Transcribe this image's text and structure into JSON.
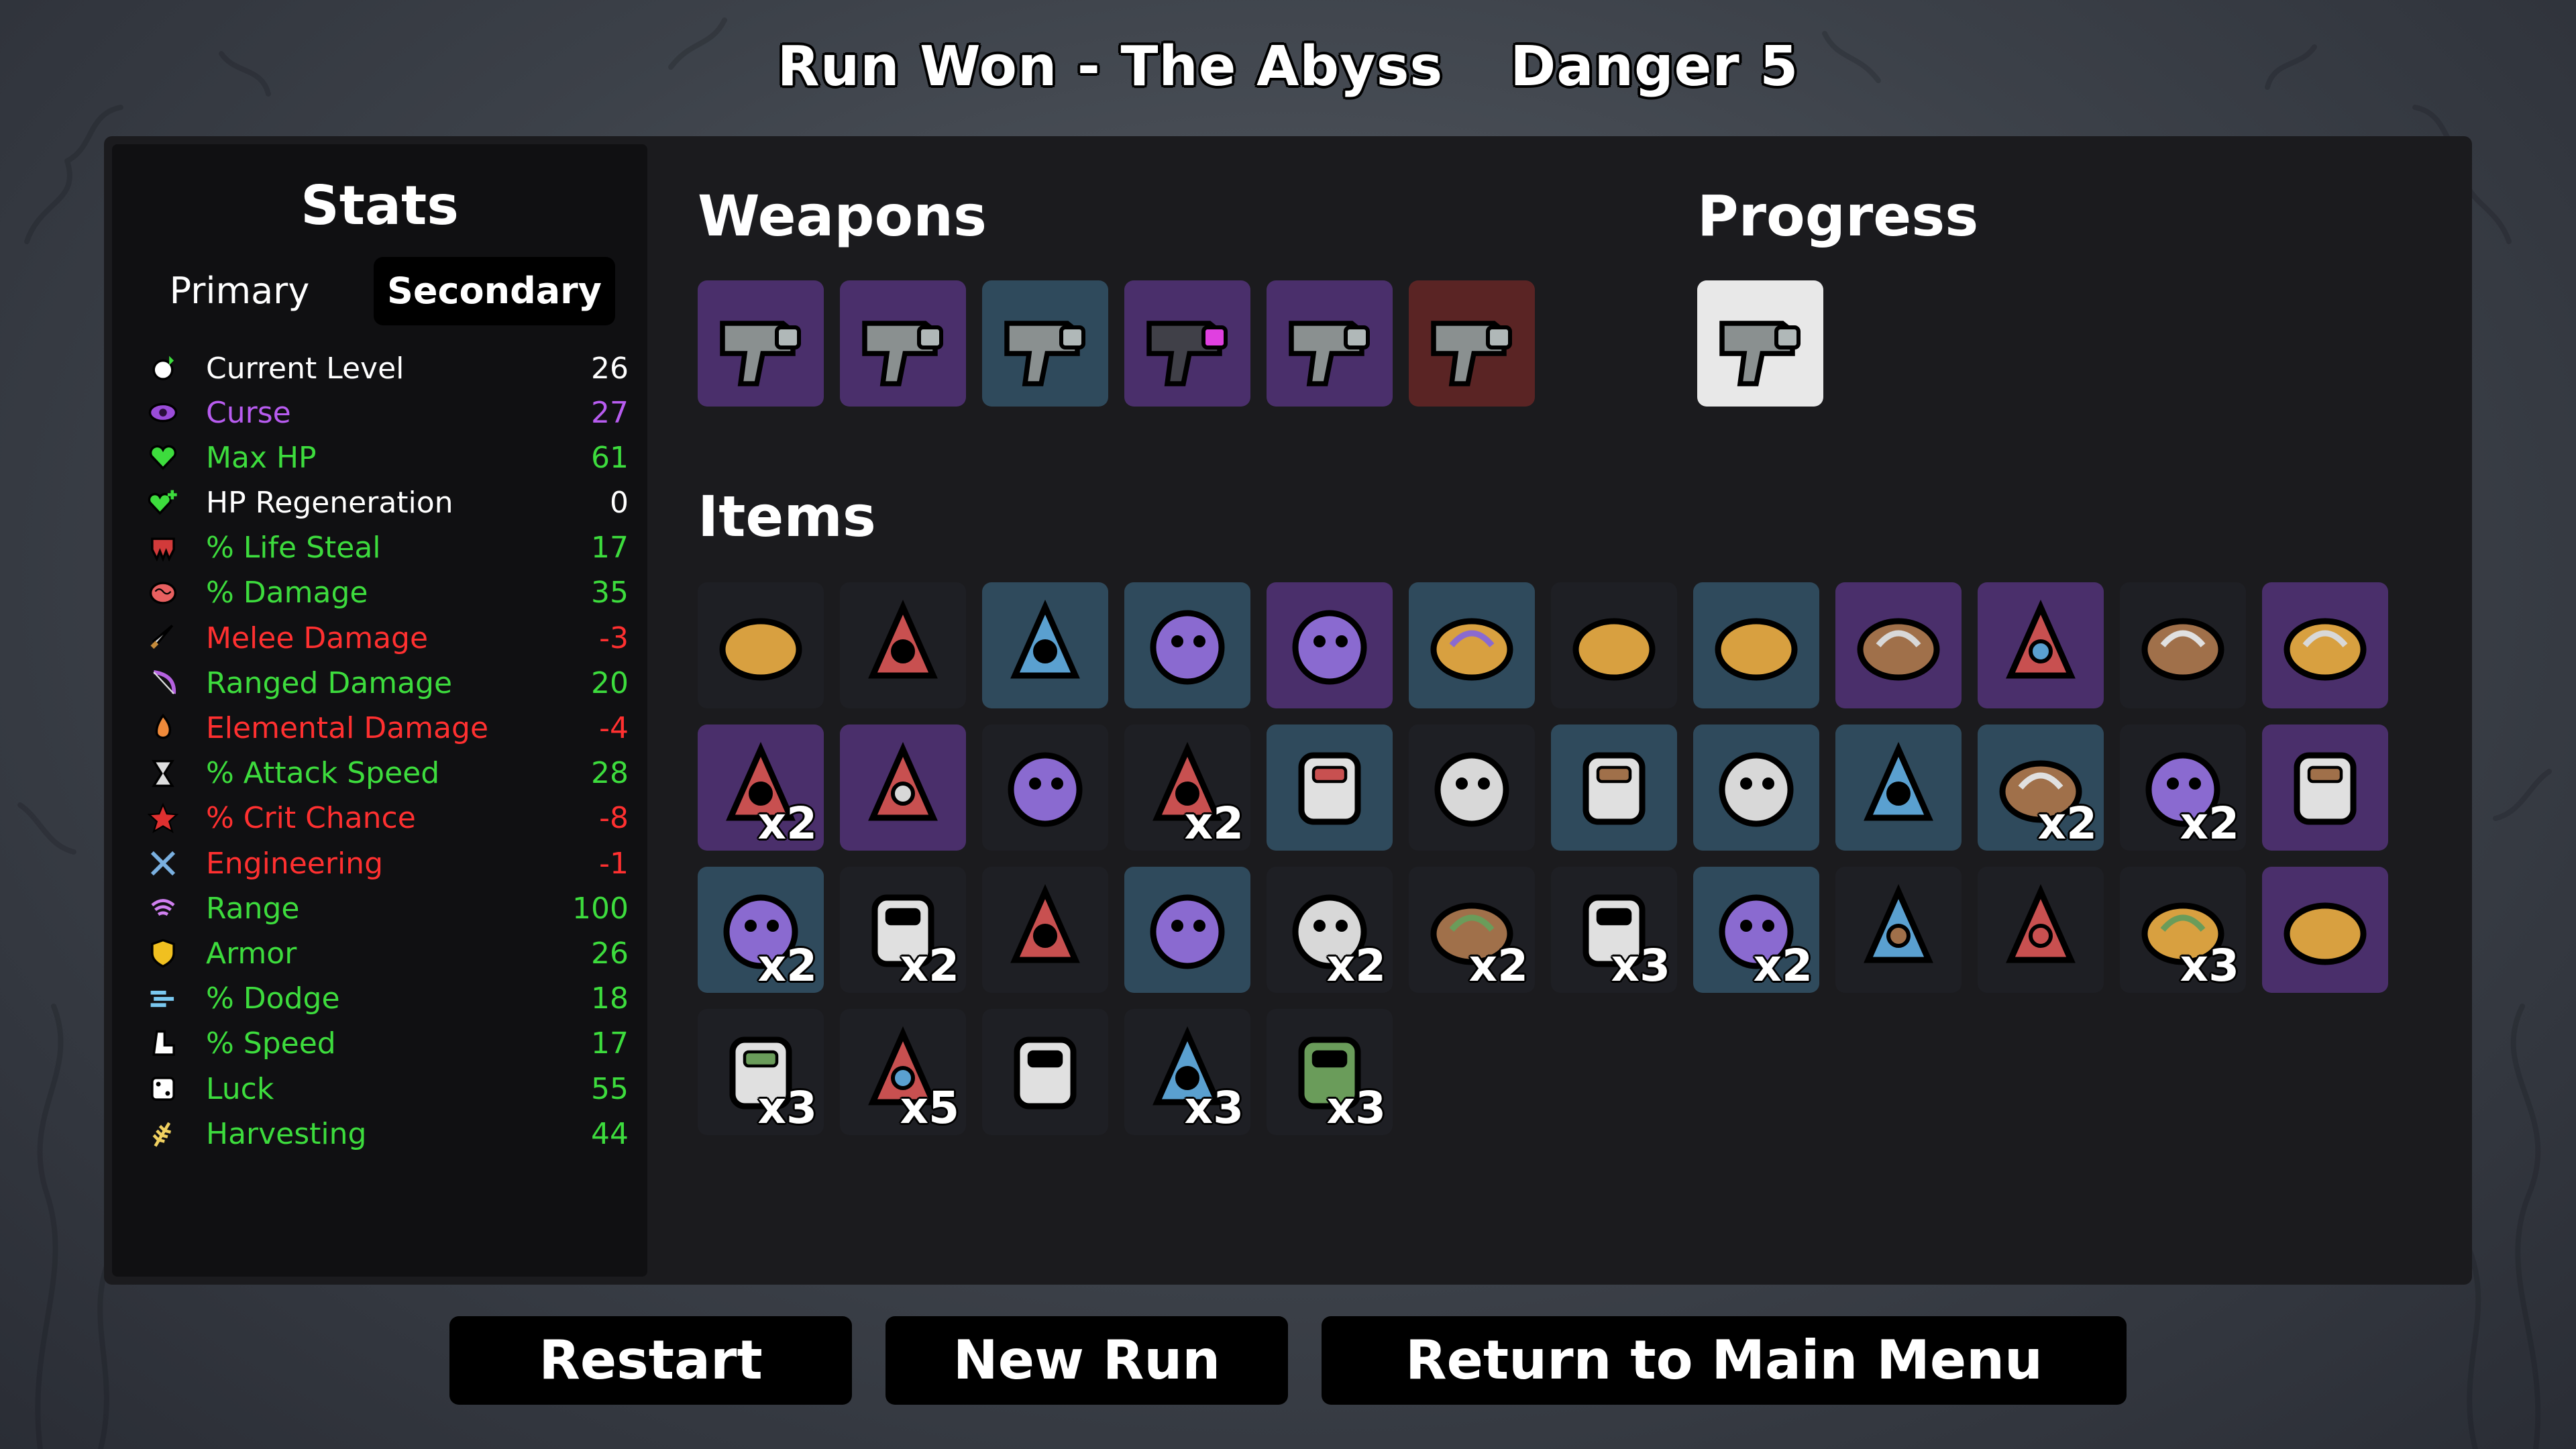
{
  "header": {
    "title": "Run Won - The Abyss",
    "danger": "Danger 5"
  },
  "stats": {
    "title": "Stats",
    "tabs": {
      "primary": "Primary",
      "secondary": "Secondary"
    },
    "rows": [
      {
        "label": "Current Level",
        "value": "26",
        "color": "#ffffff",
        "icon": "level-up-icon"
      },
      {
        "label": "Curse",
        "value": "27",
        "color": "#b85cf0",
        "icon": "curse-eye-icon"
      },
      {
        "label": "Max HP",
        "value": "61",
        "color": "#3ddc3d",
        "icon": "heart-icon"
      },
      {
        "label": "HP Regeneration",
        "value": "0",
        "color": "#ffffff",
        "icon": "heart-plus-icon"
      },
      {
        "label": "% Life Steal",
        "value": "17",
        "color": "#3ddc3d",
        "icon": "fangs-icon"
      },
      {
        "label": "% Damage",
        "value": "35",
        "color": "#3ddc3d",
        "icon": "brain-icon"
      },
      {
        "label": "Melee Damage",
        "value": "-3",
        "color": "#ff3030",
        "icon": "sword-icon"
      },
      {
        "label": "Ranged Damage",
        "value": "20",
        "color": "#3ddc3d",
        "icon": "bow-icon"
      },
      {
        "label": "Elemental Damage",
        "value": "-4",
        "color": "#ff3030",
        "icon": "flame-icon"
      },
      {
        "label": "% Attack Speed",
        "value": "28",
        "color": "#3ddc3d",
        "icon": "hourglass-icon"
      },
      {
        "label": "% Crit Chance",
        "value": "-8",
        "color": "#ff3030",
        "icon": "crit-star-icon"
      },
      {
        "label": "Engineering",
        "value": "-1",
        "color": "#ff3030",
        "icon": "wrench-icon"
      },
      {
        "label": "Range",
        "value": "100",
        "color": "#3ddc3d",
        "icon": "range-waves-icon"
      },
      {
        "label": "Armor",
        "value": "26",
        "color": "#3ddc3d",
        "icon": "shield-icon"
      },
      {
        "label": "% Dodge",
        "value": "18",
        "color": "#3ddc3d",
        "icon": "dash-icon"
      },
      {
        "label": "% Speed",
        "value": "17",
        "color": "#3ddc3d",
        "icon": "boot-icon"
      },
      {
        "label": "Luck",
        "value": "55",
        "color": "#3ddc3d",
        "icon": "dice-icon"
      },
      {
        "label": "Harvesting",
        "value": "44",
        "color": "#3ddc3d",
        "icon": "wheat-icon"
      }
    ]
  },
  "weapons": {
    "title": "Weapons",
    "items": [
      {
        "icon": "megaphone-gun-icon",
        "tier": "purple"
      },
      {
        "icon": "blaster-gun-icon",
        "tier": "purple"
      },
      {
        "icon": "blaster-gun-icon",
        "tier": "blue"
      },
      {
        "icon": "laser-gun-icon",
        "tier": "purple"
      },
      {
        "icon": "blaster-gun-icon",
        "tier": "purple"
      },
      {
        "icon": "blaster-gun-icon",
        "tier": "red"
      }
    ]
  },
  "progress": {
    "title": "Progress",
    "items": [
      {
        "icon": "flare-pistol-icon",
        "tier": "white"
      }
    ]
  },
  "items": {
    "title": "Items",
    "list": [
      {
        "icon": "disguise-face-icon",
        "tier": "dark",
        "qty": ""
      },
      {
        "icon": "dynamite-icon",
        "tier": "dark",
        "qty": ""
      },
      {
        "icon": "leech-icon",
        "tier": "blue",
        "qty": ""
      },
      {
        "icon": "torn-cloak-icon",
        "tier": "blue",
        "qty": ""
      },
      {
        "icon": "tentacle-icon",
        "tier": "purple",
        "qty": ""
      },
      {
        "icon": "helmet-visor-icon",
        "tier": "blue",
        "qty": ""
      },
      {
        "icon": "sack-mask-icon",
        "tier": "dark",
        "qty": ""
      },
      {
        "icon": "leather-armor-icon",
        "tier": "blue",
        "qty": ""
      },
      {
        "icon": "mug-icon",
        "tier": "purple",
        "qty": ""
      },
      {
        "icon": "baby-bottle-icon",
        "tier": "purple",
        "qty": ""
      },
      {
        "icon": "syringe-icon",
        "tier": "dark",
        "qty": ""
      },
      {
        "icon": "red-bandana-icon",
        "tier": "purple",
        "qty": ""
      },
      {
        "icon": "knight-helmet-icon",
        "tier": "purple",
        "qty": "x2"
      },
      {
        "icon": "scarf-icon",
        "tier": "purple",
        "qty": ""
      },
      {
        "icon": "whistle-icon",
        "tier": "dark",
        "qty": ""
      },
      {
        "icon": "propeller-hat-icon",
        "tier": "dark",
        "qty": "x2"
      },
      {
        "icon": "stone-ring-icon",
        "tier": "blue",
        "qty": ""
      },
      {
        "icon": "rubber-duck-icon",
        "tier": "dark",
        "qty": ""
      },
      {
        "icon": "pumpkin-icon",
        "tier": "blue",
        "qty": ""
      },
      {
        "icon": "flashlight-icon",
        "tier": "blue",
        "qty": ""
      },
      {
        "icon": "ketchup-bottle-icon",
        "tier": "blue",
        "qty": ""
      },
      {
        "icon": "bomb-cluster-icon",
        "tier": "blue",
        "qty": "x2"
      },
      {
        "icon": "snowball-icon",
        "tier": "dark",
        "qty": "x2"
      },
      {
        "icon": "cursed-sack-mask-icon",
        "tier": "purple",
        "qty": ""
      },
      {
        "icon": "amulet-icon",
        "tier": "blue",
        "qty": "x2"
      },
      {
        "icon": "scythe-icon",
        "tier": "dark",
        "qty": "x2"
      },
      {
        "icon": "bat-icon",
        "tier": "dark",
        "qty": ""
      },
      {
        "icon": "cauldron-icon",
        "tier": "blue",
        "qty": ""
      },
      {
        "icon": "lizard-icon",
        "tier": "dark",
        "qty": "x2"
      },
      {
        "icon": "steel-helmet-icon",
        "tier": "dark",
        "qty": "x2"
      },
      {
        "icon": "snake-icon",
        "tier": "dark",
        "qty": "x3"
      },
      {
        "icon": "hornet-icon",
        "tier": "blue",
        "qty": "x2"
      },
      {
        "icon": "crescent-moon-icon",
        "tier": "dark",
        "qty": ""
      },
      {
        "icon": "coffee-cup-icon",
        "tier": "dark",
        "qty": ""
      },
      {
        "icon": "butterfly-icon",
        "tier": "dark",
        "qty": "x3"
      },
      {
        "icon": "cracked-mirror-icon",
        "tier": "purple",
        "qty": ""
      },
      {
        "icon": "moss-rock-icon",
        "tier": "dark",
        "qty": "x3"
      },
      {
        "icon": "red-twig-icon",
        "tier": "dark",
        "qty": "x5"
      },
      {
        "icon": "tooth-icon",
        "tier": "dark",
        "qty": ""
      },
      {
        "icon": "potion-jar-icon",
        "tier": "dark",
        "qty": "x3"
      },
      {
        "icon": "pill-bag-icon",
        "tier": "dark",
        "qty": "x3"
      }
    ]
  },
  "buttons": {
    "restart": "Restart",
    "new_run": "New Run",
    "main_menu": "Return to Main Menu"
  },
  "tier_colors": {
    "dark": "#1e1f24",
    "blue": "#2f4a5c",
    "purple": "#4a2f6b",
    "red": "#5a2424",
    "white": "#e8e8e8"
  }
}
